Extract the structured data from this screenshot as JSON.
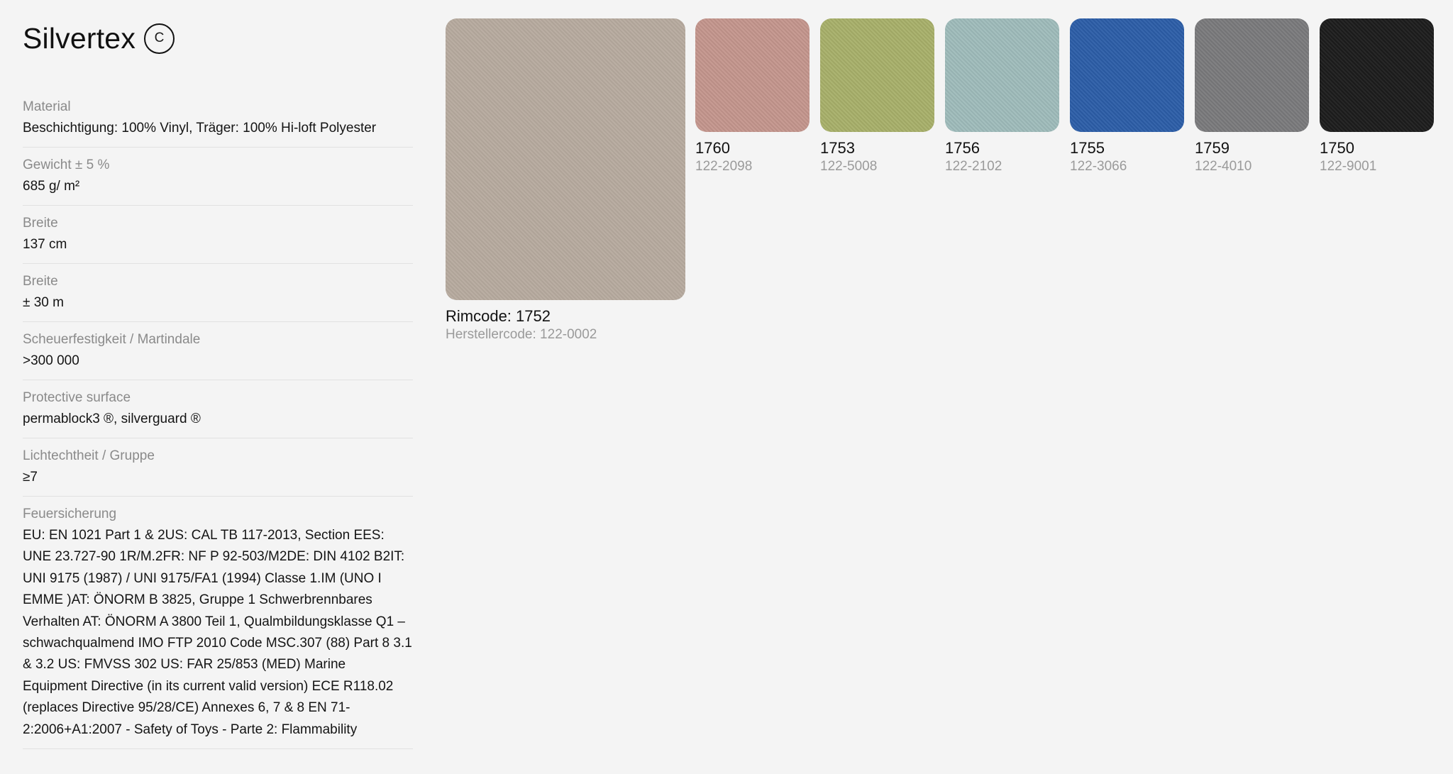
{
  "product": {
    "name": "Silvertex",
    "cert_badge": "C"
  },
  "specs": [
    {
      "label": "Material",
      "value": "Beschichtigung: 100% Vinyl, Träger: 100% Hi-loft Polyester"
    },
    {
      "label": "Gewicht ± 5 %",
      "value": "685 g/ m²"
    },
    {
      "label": "Breite",
      "value": "137 cm"
    },
    {
      "label": "Breite",
      "value": "± 30 m"
    },
    {
      "label": "Scheuerfestigkeit / Martindale",
      "value": ">300 000"
    },
    {
      "label": "Protective surface",
      "value": "permablock3 ®, silverguard ®"
    },
    {
      "label": "Lichtechtheit / Gruppe",
      "value": "≥7"
    },
    {
      "label": "Feuersicherung",
      "value": "EU: EN 1021 Part 1 & 2US: CAL TB 117-2013, Section EES: UNE 23.727-90 1R/M.2FR: NF P 92-503/M2DE: DIN 4102 B2IT: UNI 9175 (1987) / UNI 9175/FA1 (1994) Classe 1.IM (UNO I EMME )AT: ÖNORM B 3825, Gruppe 1 Schwerbrennbares Verhalten AT: ÖNORM A 3800 Teil 1, Qualmbildungsklasse Q1 – schwachqualmend IMO FTP 2010 Code MSC.307 (88) Part 8 3.1 & 3.2 US: FMVSS 302 US: FAR 25/853 (MED) Marine Equipment Directive (in its current valid version) ECE R118.02 (replaces Directive 95/28/CE) Annexes 6, 7 & 8 EN 71-2:2006+A1:2007 - Safety of Toys - Parte 2: Flammability"
    }
  ],
  "selected": {
    "rimcode": "Rimcode: 1752",
    "herstellercode": "Herstellercode: 122-0002",
    "color": "#b6aa9e"
  },
  "swatches": [
    {
      "code": "1760",
      "mfr": "122-2098",
      "color": "#c4968d"
    },
    {
      "code": "1753",
      "mfr": "122-5008",
      "color": "#a8b06a"
    },
    {
      "code": "1756",
      "mfr": "122-2102",
      "color": "#9fbcbb"
    },
    {
      "code": "1755",
      "mfr": "122-3066",
      "color": "#2c5ea8"
    },
    {
      "code": "1759",
      "mfr": "122-4010",
      "color": "#7a7a7c"
    },
    {
      "code": "1750",
      "mfr": "122-9001",
      "color": "#1c1c1c"
    }
  ]
}
